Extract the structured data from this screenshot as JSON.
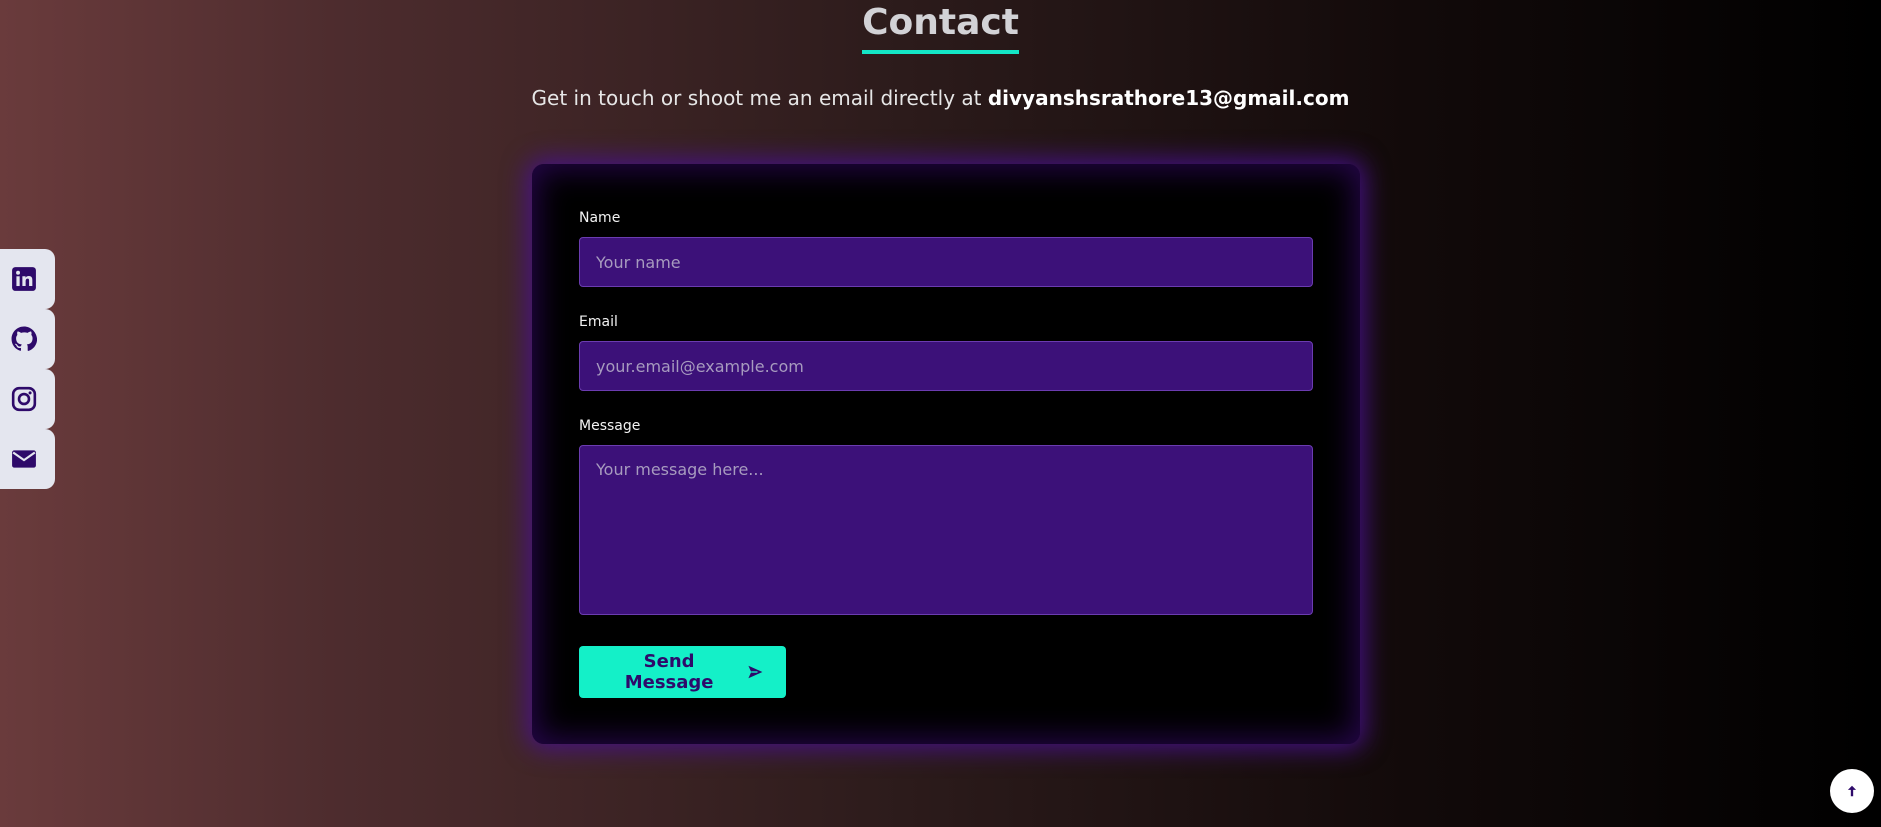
{
  "section": {
    "title": "Contact",
    "subtitle_prefix": "Get in touch or shoot me an email directly at ",
    "email": "divyanshsrathore13@gmail.com"
  },
  "form": {
    "name_label": "Name",
    "name_placeholder": "Your name",
    "email_label": "Email",
    "email_placeholder": "your.email@example.com",
    "message_label": "Message",
    "message_placeholder": "Your message here...",
    "submit_label": "Send Message",
    "submit_icon": "send-icon"
  },
  "social": [
    {
      "icon": "linkedin-icon"
    },
    {
      "icon": "github-icon"
    },
    {
      "icon": "instagram-icon"
    },
    {
      "icon": "mail-icon"
    }
  ],
  "scroll_top": {
    "icon": "arrow-up-icon"
  },
  "colors": {
    "accent": "#14f0c8",
    "input_bg": "#3c1179",
    "icon_color": "#2e0a6a",
    "card_bg": "#000000"
  }
}
